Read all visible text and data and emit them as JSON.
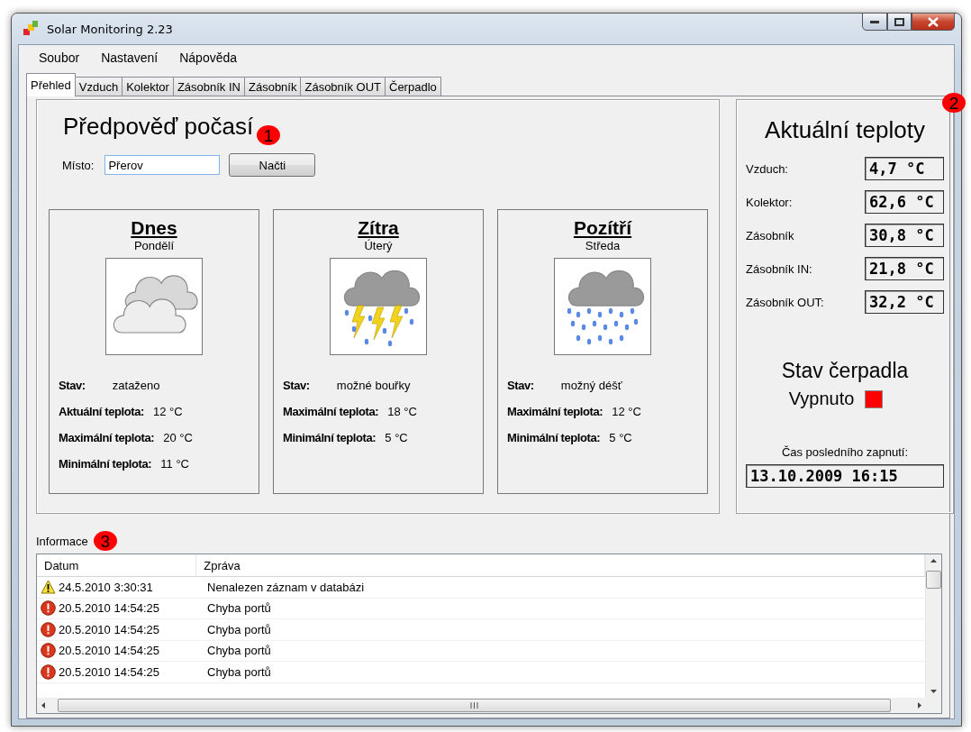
{
  "window": {
    "title": "Solar Monitoring 2.23"
  },
  "menu": [
    "Soubor",
    "Nastavení",
    "Nápověda"
  ],
  "tabs": [
    {
      "label": "Přehled",
      "selected": true
    },
    {
      "label": "Vzduch",
      "selected": false
    },
    {
      "label": "Kolektor",
      "selected": false
    },
    {
      "label": "Zásobník IN",
      "selected": false
    },
    {
      "label": "Zásobník",
      "selected": false
    },
    {
      "label": "Zásobník OUT",
      "selected": false
    },
    {
      "label": "Čerpadlo",
      "selected": false
    }
  ],
  "forecast": {
    "title": "Předpověď počasí",
    "marker": "1",
    "place_label": "Místo:",
    "place_value": "Přerov",
    "load_button": "Načti",
    "days": [
      {
        "title": "Dnes",
        "weekday": "Pondělí",
        "kind": "cloudy",
        "rows": [
          {
            "label": "Stav:",
            "value": "zataženo"
          },
          {
            "label": "Aktuální teplota:",
            "value": "12 °C"
          },
          {
            "label": "Maximální teplota:",
            "value": "20 °C"
          },
          {
            "label": "Minimální teplota:",
            "value": "11 °C"
          }
        ]
      },
      {
        "title": "Zítra",
        "weekday": "Úterý",
        "kind": "storm",
        "rows": [
          {
            "label": "Stav:",
            "value": "možné bouřky"
          },
          {
            "label": "Maximální teplota:",
            "value": "18 °C"
          },
          {
            "label": "Minimální teplota:",
            "value": "5 °C"
          }
        ]
      },
      {
        "title": "Pozítří",
        "weekday": "Středa",
        "kind": "rain",
        "rows": [
          {
            "label": "Stav:",
            "value": "možný déšť"
          },
          {
            "label": "Maximální teplota:",
            "value": "12 °C"
          },
          {
            "label": "Minimální teplota:",
            "value": "5 °C"
          }
        ]
      }
    ]
  },
  "temps": {
    "title": "Aktuální teploty",
    "marker": "2",
    "readings": [
      {
        "label": "Vzduch:",
        "value": "4,7 °C"
      },
      {
        "label": "Kolektor:",
        "value": "62,6 °C"
      },
      {
        "label": "Zásobník",
        "value": "30,8 °C"
      },
      {
        "label": "Zásobník IN:",
        "value": "21,8 °C"
      },
      {
        "label": "Zásobník OUT:",
        "value": "32,2 °C"
      }
    ],
    "pump": {
      "title": "Stav čerpadla",
      "state": "Vypnuto",
      "on": false
    },
    "last_on_label": "Čas posledního zapnutí:",
    "last_on_value": "13.10.2009 16:15"
  },
  "log": {
    "title": "Informace",
    "marker": "3",
    "columns": [
      "Datum",
      "Zpráva"
    ],
    "rows": [
      {
        "kind": "warning",
        "date": "24.5.2010 3:30:31",
        "message": "Nenalezen záznam v databázi"
      },
      {
        "kind": "error",
        "date": "20.5.2010 14:54:25",
        "message": "Chyba portů"
      },
      {
        "kind": "error",
        "date": "20.5.2010 14:54:25",
        "message": "Chyba portů"
      },
      {
        "kind": "error",
        "date": "20.5.2010 14:54:25",
        "message": "Chyba portů"
      },
      {
        "kind": "error",
        "date": "20.5.2010 14:54:25",
        "message": "Chyba portů"
      }
    ]
  }
}
